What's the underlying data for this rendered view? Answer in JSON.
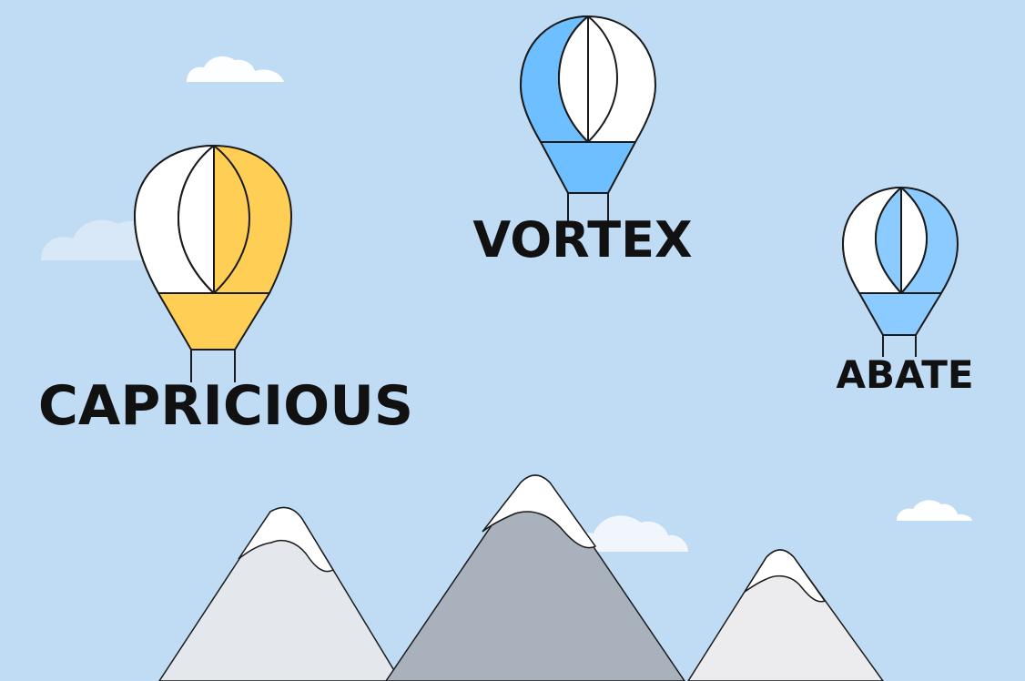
{
  "game": {
    "balloons": [
      {
        "word": "CAPRICIOUS",
        "color": "#ffcf55",
        "icon": "hot-air-balloon-icon"
      },
      {
        "word": "VORTEX",
        "color": "#6ebfff",
        "icon": "hot-air-balloon-icon"
      },
      {
        "word": "ABATE",
        "color": "#8ccbff",
        "icon": "hot-air-balloon-icon"
      }
    ]
  },
  "colors": {
    "sky": "#c0dcf5",
    "cloud": "#ffffff",
    "mountain_left": "#e4e7ec",
    "mountain_center": "#a9b1bc",
    "mountain_right": "#ececee",
    "snow": "#ffffff",
    "outline": "#1a1a1a",
    "text": "#111111"
  },
  "scenery": {
    "cloud_icon": "cloud-icon",
    "mountain_icon": "mountain-icon"
  }
}
